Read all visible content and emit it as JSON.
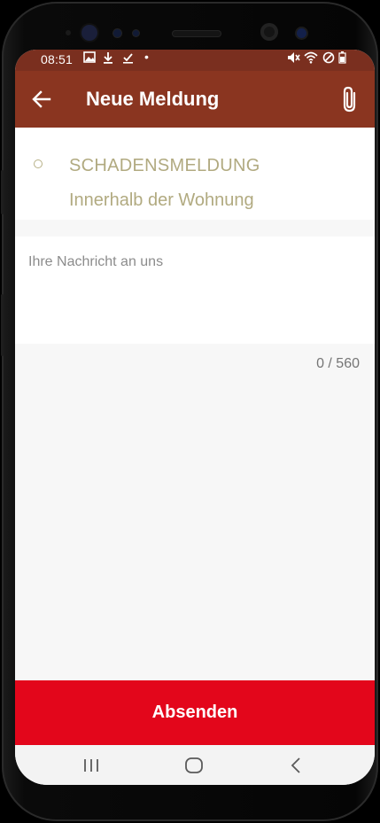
{
  "status_bar": {
    "time": "08:51",
    "icons": [
      "image-icon",
      "download-icon",
      "checkmark-icon",
      "dot-icon",
      "mute-icon",
      "wifi-icon",
      "do-not-disturb-icon",
      "battery-icon"
    ]
  },
  "app_bar": {
    "title": "Neue Meldung",
    "back_icon": "arrow-left-icon",
    "attach_icon": "paperclip-icon"
  },
  "report_type": {
    "category": "SCHADENSMELDUNG",
    "subcategory": "Innerhalb der Wohnung",
    "accent_color": "#b1aa80"
  },
  "message": {
    "placeholder": "Ihre Nachricht an uns",
    "value": "",
    "counter": "0 / 560"
  },
  "submit": {
    "label": "Absenden",
    "color": "#e3061b"
  },
  "nav_bar": {
    "recents_icon": "recents-icon",
    "home_icon": "home-icon",
    "back_icon": "chevron-left-icon"
  },
  "colors": {
    "status_bar": "#7a2f1f",
    "app_bar": "#8a3520",
    "background": "#f7f7f7"
  }
}
